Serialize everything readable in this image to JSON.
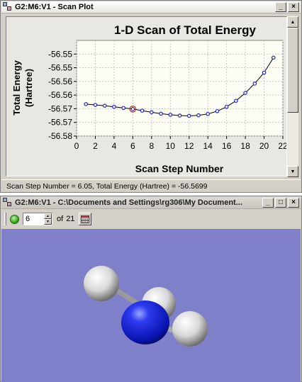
{
  "scan_window": {
    "title": "G2:M6:V1 - Scan Plot",
    "controls": [
      "_",
      "×"
    ]
  },
  "chart_data": {
    "type": "line",
    "title": "1-D Scan of Total Energy",
    "xlabel": "Scan Step Number",
    "ylabel_line1": "Total Energy",
    "ylabel_line2": "(Hartree)",
    "xlim": [
      0,
      22
    ],
    "ylim": [
      -56.58,
      -56.545
    ],
    "x_ticks": [
      "0",
      "2",
      "4",
      "6",
      "8",
      "10",
      "12",
      "14",
      "16",
      "18",
      "20",
      "22"
    ],
    "y_ticks": [
      "-56.55",
      "-56.55",
      "-56.56",
      "-56.56",
      "-56.57",
      "-56.57",
      "-56.58"
    ],
    "y_tick_values": [
      -56.55,
      -56.555,
      -56.56,
      -56.565,
      -56.57,
      -56.575,
      -56.58
    ],
    "x": [
      1,
      2,
      3,
      4,
      5,
      6,
      7,
      8,
      9,
      10,
      11,
      12,
      13,
      14,
      15,
      16,
      17,
      18,
      19,
      20,
      21
    ],
    "y": [
      -56.5683,
      -56.5686,
      -56.5689,
      -56.5693,
      -56.5697,
      -56.5701,
      -56.5707,
      -56.5713,
      -56.5718,
      -56.5722,
      -56.5725,
      -56.5726,
      -56.5724,
      -56.5719,
      -56.5709,
      -56.5693,
      -56.5671,
      -56.5642,
      -56.5608,
      -56.5568,
      -56.5513
    ],
    "selected_x": 6,
    "grid": true,
    "line_color": "#000000",
    "marker_color": "#2222cc",
    "selected_color": "#cc2222"
  },
  "status": {
    "text": "Scan Step Number = 6.05,  Total Energy (Hartree) = -56.5699"
  },
  "mol_window": {
    "title": "G2:M6:V1 - C:\\Documents and Settings\\rg306\\My Document...",
    "controls": [
      "_",
      "□",
      "×"
    ],
    "step_value": "6",
    "of_label": "of",
    "total_steps": "21",
    "background_color": "#7f7fca"
  }
}
